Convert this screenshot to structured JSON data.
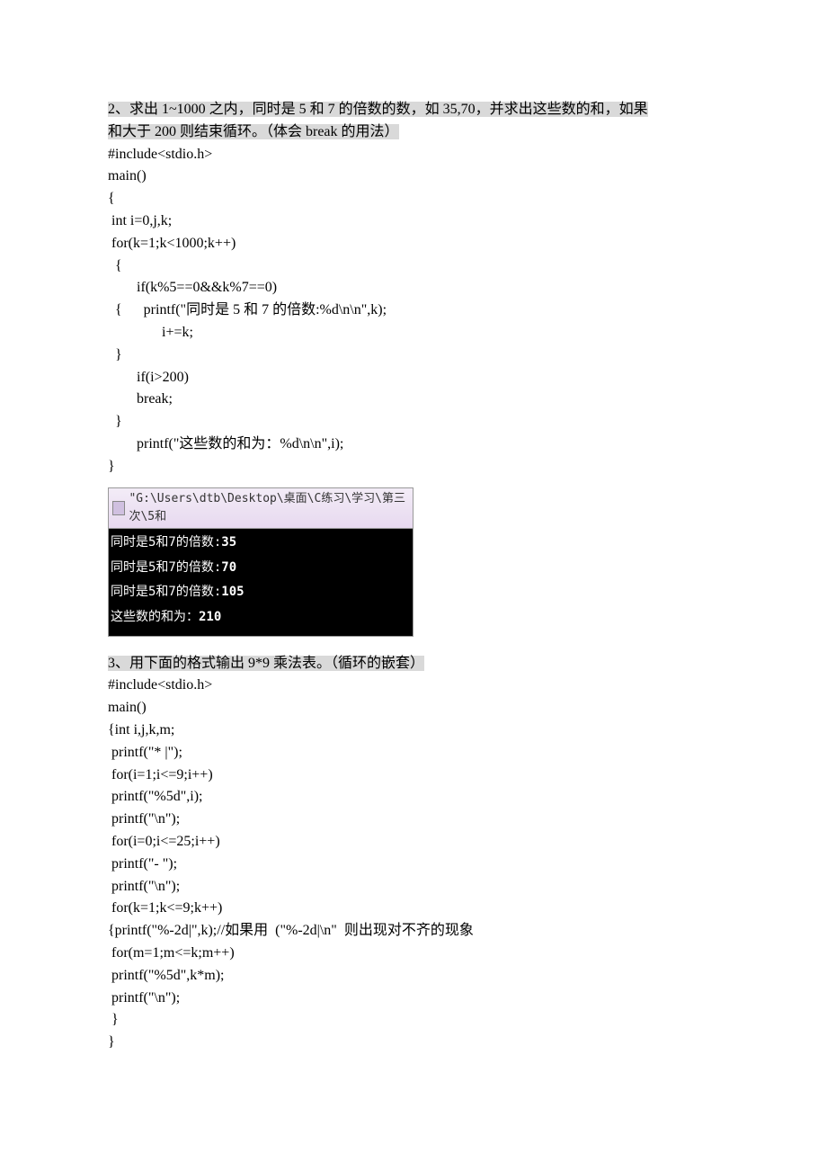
{
  "problem2": {
    "title_line1": "2、求出 1~1000 之内，同时是 5 和 7 的倍数的数，如 35,70，并求出这些数的和，如果",
    "title_line2": "和大于 200 则结束循环。（体会 break 的用法）",
    "code": [
      "#include<stdio.h>",
      "main()",
      "{",
      " int i=0,j,k;",
      " for(k=1;k<1000;k++)",
      "  {",
      "        if(k%5==0&&k%7==0)",
      "  {      printf(\"同时是 5 和 7 的倍数:%d\\n\\n\",k);",
      "               i+=k;",
      "  }",
      "        if(i>200)",
      "        break;",
      "  }",
      "        printf(\"这些数的和为：%d\\n\\n\",i);",
      "}"
    ],
    "console": {
      "title": "\"G:\\Users\\dtb\\Desktop\\桌面\\C练习\\学习\\第三次\\5和",
      "lines": [
        {
          "label": "同时是5和7的倍数:",
          "value": "35"
        },
        {
          "label": "同时是5和7的倍数:",
          "value": "70"
        },
        {
          "label": "同时是5和7的倍数:",
          "value": "105"
        },
        {
          "label": "这些数的和为：",
          "value": "210"
        }
      ]
    }
  },
  "problem3": {
    "title": "3、用下面的格式输出 9*9 乘法表。（循环的嵌套）",
    "code": [
      "#include<stdio.h>",
      "main()",
      "{int i,j,k,m;",
      " printf(\"* |\");",
      " for(i=1;i<=9;i++)",
      " printf(\"%5d\",i);",
      " printf(\"\\n\");",
      " for(i=0;i<=25;i++)",
      " printf(\"- \");",
      " printf(\"\\n\");",
      " for(k=1;k<=9;k++)",
      "{printf(\"%-2d|\",k);//如果用  (\"%-2d|\\n\"  则出现对不齐的现象",
      " for(m=1;m<=k;m++)",
      " printf(\"%5d\",k*m);",
      " printf(\"\\n\");",
      " }",
      "}"
    ]
  }
}
